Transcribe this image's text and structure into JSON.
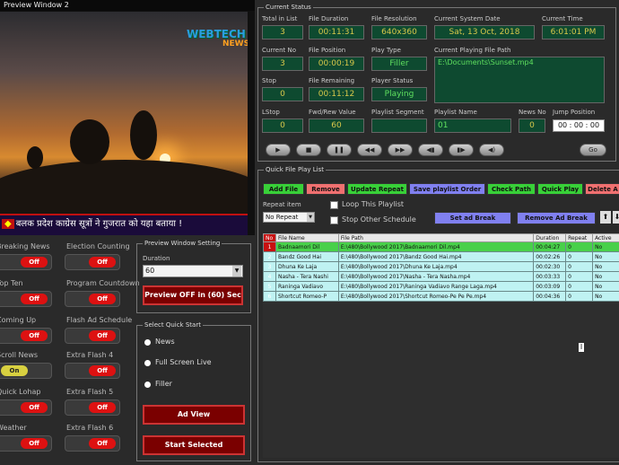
{
  "preview": {
    "title": "Preview Window 2",
    "logo_main": "WEBTECH",
    "logo_sub": "NEWS",
    "ticker_text": "बलक प्रदेश काग्रेस सूत्रों ने गुजरात को यहा बताया !"
  },
  "toggles": {
    "col1": [
      {
        "label": "Breaking News",
        "state": "Off"
      },
      {
        "label": "Top Ten",
        "state": "Off"
      },
      {
        "label": "Coming Up",
        "state": "Off"
      },
      {
        "label": "Scroll News",
        "state": "On"
      },
      {
        "label": "Quick Lohap",
        "state": "Off"
      },
      {
        "label": "Weather",
        "state": "Off"
      }
    ],
    "col2": [
      {
        "label": "Election Counting",
        "state": "Off"
      },
      {
        "label": "Program Countdown",
        "state": "Off"
      },
      {
        "label": "Flash Ad Schedule",
        "state": "Off"
      },
      {
        "label": "Extra Flash 4",
        "state": "Off"
      },
      {
        "label": "Extra Flash 5",
        "state": "Off"
      },
      {
        "label": "Extra Flash 6",
        "state": "Off"
      }
    ]
  },
  "preview_setting": {
    "title": "Preview Window Setting",
    "duration_label": "Duration",
    "duration_value": "60",
    "preview_button": "Preview OFF in (60) Sec"
  },
  "quick_start": {
    "title": "Select Quick Start",
    "options": [
      "News",
      "Full Screen Live",
      "Filler"
    ],
    "ad_view_button": "Ad View",
    "start_selected_button": "Start Selected"
  },
  "status": {
    "title": "Current Status",
    "total_in_list_label": "Total in List",
    "total_in_list": "3",
    "file_duration_label": "File Duration",
    "file_duration": "00:11:31",
    "file_resolution_label": "File Resolution",
    "file_resolution": "640x360",
    "system_date_label": "Current System Date",
    "system_date": "Sat, 13 Oct, 2018",
    "current_time_label": "Current Time",
    "current_time": "6:01:01 PM",
    "current_no_label": "Current No",
    "current_no": "3",
    "file_position_label": "File Position",
    "file_position": "00:00:19",
    "play_type_label": "Play Type",
    "play_type": "Filler",
    "current_file_label": "Current Playing File Path",
    "current_file": "E:\\Documents\\Sunset.mp4",
    "stop_label": "Stop",
    "stop": "0",
    "file_remaining_label": "File Remaining",
    "file_remaining": "00:11:12",
    "player_status_label": "Player Status",
    "player_status": "Playing",
    "lstop_label": "LStop",
    "lstop": "0",
    "fwd_label": "Fwd/Rew Value",
    "fwd": "60",
    "playlist_segment_label": "Playlist Segment",
    "playlist_segment": "",
    "playlist_name_label": "Playlist Name",
    "playlist_name": "01",
    "news_no_label": "News No",
    "news_no": "0",
    "jump_label": "Jump Position",
    "jump": "00 : 00 : 00",
    "controls": [
      "▶",
      "■",
      "❚❚",
      "◀◀",
      "▶▶",
      "◀▮",
      "▮▶",
      "◀)"
    ],
    "go_label": "Go"
  },
  "playlist": {
    "title": "Quick File Play List",
    "buttons": [
      {
        "label": "Add File",
        "color": "#38d038"
      },
      {
        "label": "Remove",
        "color": "#f07070"
      },
      {
        "label": "Update Repeat",
        "color": "#38d038"
      },
      {
        "label": "Save playlist Order",
        "color": "#8080f0"
      },
      {
        "label": "Check Path",
        "color": "#38d038"
      },
      {
        "label": "Quick Play",
        "color": "#38d038"
      },
      {
        "label": "Delete A",
        "color": "#f07070"
      }
    ],
    "repeat_label": "Repeat item",
    "repeat_value": "No Repeat",
    "loop_label": "Loop This Playlist",
    "stop_other_label": "Stop Other Schedule",
    "set_ad_break": "Set ad Break",
    "remove_ad_break": "Remove Ad Break",
    "columns": [
      "No",
      "File Name",
      "File Path",
      "Duration",
      "Repeat",
      "Active"
    ],
    "rows": [
      {
        "no": "1",
        "name": "Badnaamori Dil",
        "path": "E:\\480\\Bollywood 2017\\Badnaamori Dil.mp4",
        "duration": "00:04:27",
        "repeat": "0",
        "active": "No",
        "selected": true
      },
      {
        "no": "2",
        "name": "Bandz Good Hai",
        "path": "E:\\480\\Bollywood 2017\\Bandz Good Hai.mp4",
        "duration": "00:02:26",
        "repeat": "0",
        "active": "No",
        "selected": false
      },
      {
        "no": "3",
        "name": "Dhuna Ke Laja",
        "path": "E:\\480\\Bollywood 2017\\Dhuna Ke Laja.mp4",
        "duration": "00:02:30",
        "repeat": "0",
        "active": "No",
        "selected": false
      },
      {
        "no": "4",
        "name": "Nasha - Tera Nashi",
        "path": "E:\\480\\Bollywood 2017\\Nasha - Tera Nasha.mp4",
        "duration": "00:03:33",
        "repeat": "0",
        "active": "No",
        "selected": false
      },
      {
        "no": "5",
        "name": "Raninga Vadiavo",
        "path": "E:\\480\\Bollywood 2017\\Raninga Vadiavo Range Laga.mp4",
        "duration": "00:03:09",
        "repeat": "0",
        "active": "No",
        "selected": false
      },
      {
        "no": "6",
        "name": "Shortcut Romeo-P",
        "path": "E:\\480\\Bollywood 2017\\Shortcut Romeo-Pe Pe Pe.mp4",
        "duration": "00:04:36",
        "repeat": "0",
        "active": "No",
        "selected": false
      }
    ],
    "cursor_glyph": "I"
  }
}
